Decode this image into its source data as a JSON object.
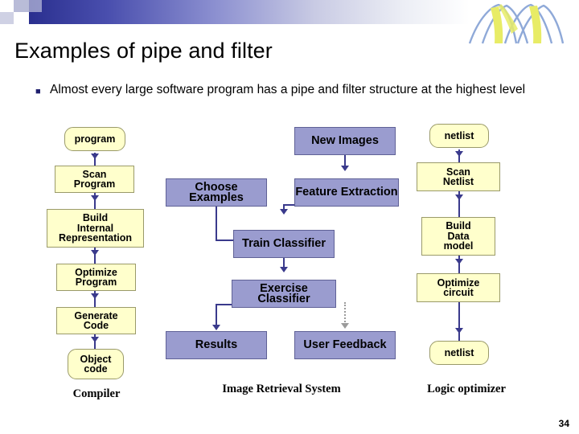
{
  "slide": {
    "title": "Examples of pipe and filter",
    "bullet_marker": "■",
    "bullet_text": "Almost every large software program has a pipe and filter structure at the highest level",
    "page_number": "34"
  },
  "diagram": {
    "columns": [
      {
        "caption": "Compiler",
        "nodes": [
          {
            "label": "program",
            "shape": "round",
            "color": "yellow"
          },
          {
            "label": "Scan\nProgram",
            "shape": "rect",
            "color": "yellow"
          },
          {
            "label": "Build\nInternal\nRepresentation",
            "shape": "rect",
            "color": "yellow"
          },
          {
            "label": "Optimize\nProgram",
            "shape": "rect",
            "color": "yellow"
          },
          {
            "label": "Generate\nCode",
            "shape": "rect",
            "color": "yellow"
          },
          {
            "label": "Object\ncode",
            "shape": "round",
            "color": "yellow"
          }
        ]
      },
      {
        "caption": "Image Retrieval System",
        "nodes": [
          {
            "label": "New Images",
            "shape": "rect",
            "color": "purple"
          },
          {
            "label": "Choose Examples",
            "shape": "rect",
            "color": "purple"
          },
          {
            "label": "Feature Extraction",
            "shape": "rect",
            "color": "purple"
          },
          {
            "label": "Train Classifier",
            "shape": "rect",
            "color": "purple"
          },
          {
            "label": "Exercise Classifier",
            "shape": "rect",
            "color": "purple"
          },
          {
            "label": "Results",
            "shape": "rect",
            "color": "purple"
          },
          {
            "label": "User Feedback",
            "shape": "rect",
            "color": "purple"
          }
        ]
      },
      {
        "caption": "Logic optimizer",
        "nodes": [
          {
            "label": "netlist",
            "shape": "round",
            "color": "yellow"
          },
          {
            "label": "Scan\nNetlist",
            "shape": "rect",
            "color": "yellow"
          },
          {
            "label": "Build\nData\nmodel",
            "shape": "rect",
            "color": "yellow"
          },
          {
            "label": "Optimize\ncircuit",
            "shape": "rect",
            "color": "yellow"
          },
          {
            "label": "netlist",
            "shape": "round",
            "color": "yellow"
          }
        ]
      }
    ]
  },
  "colors": {
    "yellow_node": "#ffffcc",
    "purple_node": "#9a9ccf",
    "connector": "#3a3a8c",
    "band_start": "#2a2f8f"
  }
}
